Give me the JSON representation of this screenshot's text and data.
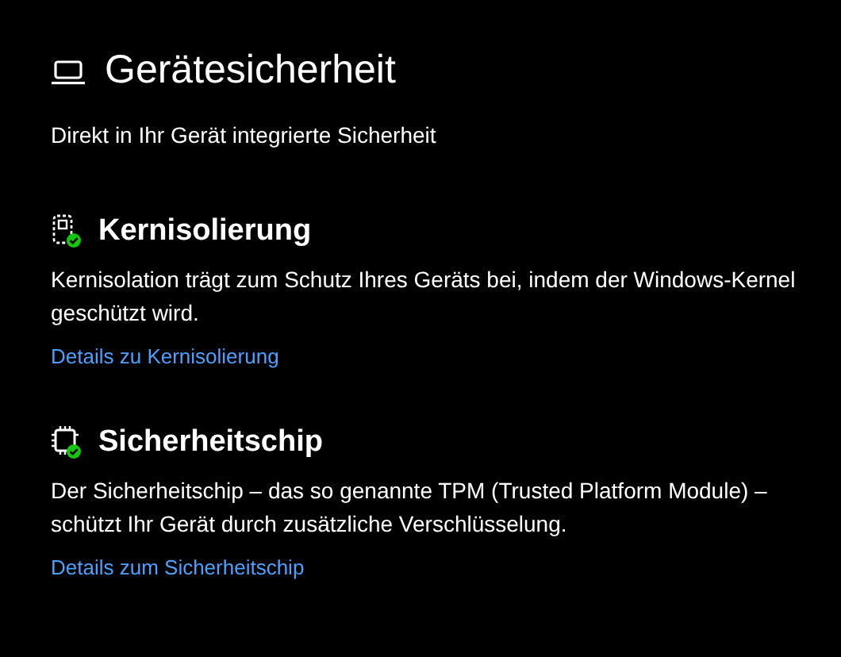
{
  "page": {
    "title": "Gerätesicherheit",
    "subtitle": "Direkt in Ihr Gerät integrierte Sicherheit"
  },
  "sections": [
    {
      "kind": "isolation",
      "ok": true,
      "title": "Kernisolierung",
      "text": "Kernisolation trägt zum Schutz Ihres Geräts bei, indem der Windows-Kernel geschützt wird.",
      "link": "Details zu Kernisolierung"
    },
    {
      "kind": "chip",
      "ok": true,
      "title": "Sicherheitschip",
      "text": "Der Sicherheitschip – das so genannte TPM (Trusted Platform Module) – schützt Ihr Gerät durch zusätzliche Verschlüsselung.",
      "link": "Details zum Sicherheitschip"
    }
  ]
}
